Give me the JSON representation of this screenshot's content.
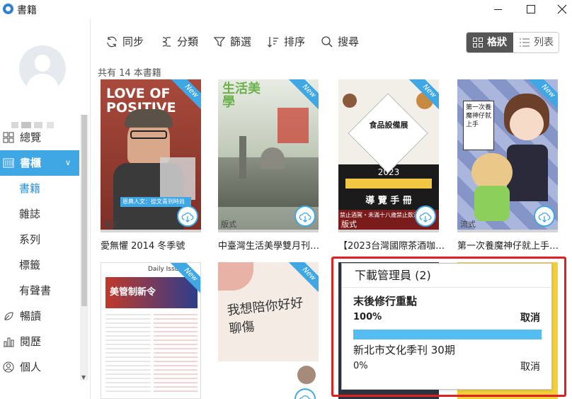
{
  "window": {
    "title": "書籍"
  },
  "sidebar": {
    "nav": [
      {
        "label": "總覽",
        "icon": "grid-icon"
      },
      {
        "label": "書櫃",
        "icon": "bookshelf-icon",
        "active": true,
        "chevron": "∨"
      },
      {
        "label": "暢讀",
        "icon": "leaf-icon"
      },
      {
        "label": "閱歷",
        "icon": "chart-icon"
      },
      {
        "label": "個人",
        "icon": "person-icon"
      }
    ],
    "sub": [
      "書籍",
      "雜誌",
      "系列",
      "標籤",
      "有聲書"
    ]
  },
  "toolbar": {
    "sync": "同步",
    "category": "分類",
    "filter": "篩選",
    "sort": "排序",
    "search": "搜尋",
    "view_grid": "格狀",
    "view_list": "列表"
  },
  "content": {
    "count_text": "共有 14 本書籍",
    "new_badge": "New",
    "books": [
      {
        "title": "愛無懼 2014 冬季號",
        "type": "流式",
        "cover_bg": "#9a3a2e",
        "cover_text": "LOVE OF POSITIVE",
        "cover_caption": "恩典人文：從文青到時尚"
      },
      {
        "title": "中臺灣生活美學雙月刊…",
        "type": "版式",
        "cover_bg": "#b8c4b0",
        "cover_text": "生活美學"
      },
      {
        "title": "【2023台灣國際茶酒咖…",
        "type": "版式",
        "cover_bg": "#1b1b1b",
        "cover_text": "食品設備展",
        "cover_caption": "2023",
        "cover_caption2": "導 覽 手 冊",
        "cover_caption3": "禁止酒駕・未滿十八歲禁止飲酒"
      },
      {
        "title": "第一次養魔神仔就上手…",
        "type": "流式",
        "cover_bg": "#7d8fc2",
        "cover_text": "第一次養魔神仔就上手"
      },
      {
        "title": "",
        "type": "",
        "cover_bg": "#ffffff",
        "cover_text": "美管制新令",
        "cover_caption": "Daily Issue"
      },
      {
        "title": "",
        "type": "",
        "cover_bg": "#f4ece4",
        "cover_text": "我想陪你好好聊傷"
      }
    ]
  },
  "download_manager": {
    "title": "下載管理員 (2)",
    "items": [
      {
        "name": "末後修行重點",
        "progress_text": "100%",
        "progress": 1.0,
        "cancel": "取消"
      },
      {
        "name": "新北市文化季刊  30期",
        "progress_text": "0%",
        "progress": 0.0,
        "cancel": "取消"
      }
    ]
  },
  "colors": {
    "accent": "#3fa7e4",
    "highlight_border": "#e02020",
    "progress_fill": "#55bdf0"
  }
}
